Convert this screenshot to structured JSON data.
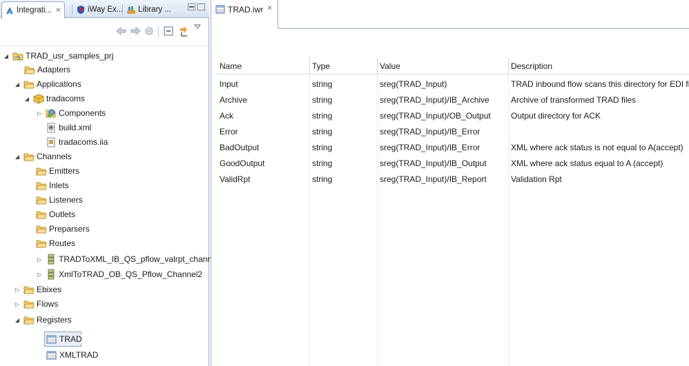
{
  "left_panel": {
    "tabs": [
      {
        "label": "Integrati...",
        "icon": "integration-explorer-icon",
        "closable": true
      },
      {
        "label": "iWay Ex...",
        "icon": "iway-explorer-icon",
        "closable": false
      },
      {
        "label": "Library ...",
        "icon": "library-icon",
        "closable": false
      }
    ],
    "toolbar_icons": [
      "back-arrow-icon",
      "forward-arrow-icon",
      "home-icon",
      "collapse-all-icon",
      "link-editor-icon",
      "view-menu-icon"
    ],
    "tree": {
      "project": "TRAD_usr_samples_prj",
      "adapters": "Adapters",
      "applications": "Applications",
      "app_tradacoms": "tradacoms",
      "components": "Components",
      "build_xml": "build.xml",
      "tradacoms_iia": "tradacoms.iia",
      "channels": "Channels",
      "emitters": "Emitters",
      "inlets": "Inlets",
      "listeners": "Listeners",
      "outlets": "Outlets",
      "preparsers": "Preparsers",
      "routes": "Routes",
      "channel1": "TRADToXML_IB_QS_pflow_valrpt_channel",
      "channel2": "XmlToTRAD_OB_QS_Pflow_Channel2",
      "ebixes": "Ebixes",
      "flows": "Flows",
      "registers": "Registers",
      "reg_trad": "TRAD",
      "reg_xmltrad": "XMLTRAD"
    }
  },
  "editor": {
    "tab_label": "TRAD.iwr",
    "columns": [
      "Name",
      "Type",
      "Value",
      "Description"
    ],
    "rows": [
      {
        "name": "Input",
        "type": "string",
        "value": "sreg(TRAD_Input)",
        "description": "TRAD inbound flow scans this directory for EDI files"
      },
      {
        "name": "Archive",
        "type": "string",
        "value": "sreg(TRAD_Input)/IB_Archive",
        "description": "Archive of transformed TRAD files"
      },
      {
        "name": "Ack",
        "type": "string",
        "value": "sreg(TRAD_Input)/OB_Output",
        "description": "Output directory for ACK"
      },
      {
        "name": "Error",
        "type": "string",
        "value": "sreg(TRAD_Input)/IB_Error",
        "description": ""
      },
      {
        "name": "BadOutput",
        "type": "string",
        "value": "sreg(TRAD_Input)/IB_Error",
        "description": "XML where ack status is not equal to A(accept)"
      },
      {
        "name": "GoodOutput",
        "type": "string",
        "value": "sreg(TRAD_Input)/IB_Output",
        "description": "XML where ack status equal to A (accept)"
      },
      {
        "name": "ValidRpt",
        "type": "string",
        "value": "sreg(TRAD_Input)/IB_Report",
        "description": "Validation Rpt"
      }
    ]
  },
  "colors": {
    "folder": "#e8b84a",
    "tab_bg": "#d8e3f1",
    "border": "#9aa9bd"
  }
}
